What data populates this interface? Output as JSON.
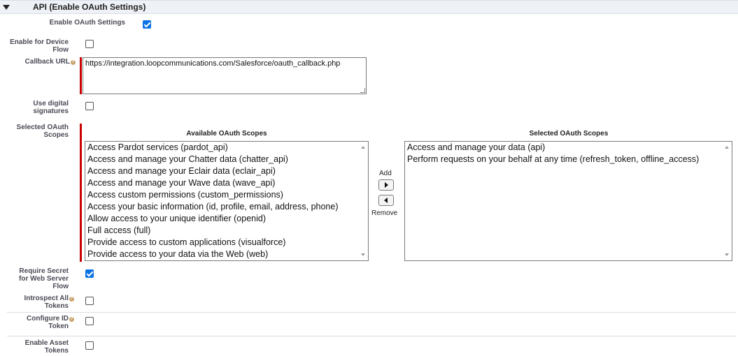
{
  "section": {
    "title": "API (Enable OAuth Settings)"
  },
  "fields": {
    "enable_oauth": {
      "label": "Enable OAuth Settings",
      "checked": true
    },
    "device_flow": {
      "label_line1": "Enable for Device",
      "label_line2": "Flow",
      "checked": false
    },
    "callback_url": {
      "label": "Callback URL",
      "value": "https://integration.loopcommunications.com/Salesforce/oauth_callback.php"
    },
    "digital_signatures": {
      "label_line1": "Use digital",
      "label_line2": "signatures",
      "checked": false
    },
    "selected_scopes": {
      "label_line1": "Selected OAuth",
      "label_line2": "Scopes"
    },
    "require_secret": {
      "label_line1": "Require Secret",
      "label_line2": "for Web Server",
      "label_line3": "Flow",
      "checked": true
    },
    "introspect_tokens": {
      "label_line1": "Introspect All",
      "label_line2": "Tokens",
      "checked": false
    },
    "configure_id_token": {
      "label_line1": "Configure ID",
      "label_line2": "Token",
      "checked": false
    },
    "asset_tokens": {
      "label_line1": "Enable Asset",
      "label_line2": "Tokens",
      "checked": false
    }
  },
  "scopes": {
    "available_title": "Available OAuth Scopes",
    "selected_title": "Selected OAuth Scopes",
    "add_label": "Add",
    "remove_label": "Remove",
    "available": [
      "Access Pardot services (pardot_api)",
      "Access and manage your Chatter data (chatter_api)",
      "Access and manage your Eclair data (eclair_api)",
      "Access and manage your Wave data (wave_api)",
      "Access custom permissions (custom_permissions)",
      "Access your basic information (id, profile, email, address, phone)",
      "Allow access to your unique identifier (openid)",
      "Full access (full)",
      "Provide access to custom applications (visualforce)",
      "Provide access to your data via the Web (web)"
    ],
    "selected": [
      "Access and manage your data (api)",
      "Perform requests on your behalf at any time (refresh_token, offline_access)"
    ]
  },
  "icons": {
    "collapse": "triangle-down-icon",
    "help": "help-icon",
    "add": "arrow-right-icon",
    "remove": "arrow-left-icon"
  }
}
